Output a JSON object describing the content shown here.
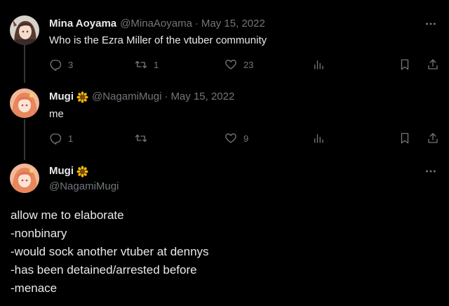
{
  "colors": {
    "background": "#000000",
    "text": "#e7e9ea",
    "muted": "#71767b",
    "thread_line": "#333639"
  },
  "tweets": [
    {
      "name": "Mina Aoyama",
      "handle": "@MinaAoyama",
      "separator": "·",
      "date": "May 15, 2022",
      "text": "Who is the Ezra Miller of the vtuber community",
      "avatar_icon": "avatar-mina-icon",
      "actions": {
        "reply": "3",
        "retweet": "1",
        "like": "23"
      }
    },
    {
      "name": "Mugi",
      "name_emoji": "sunflower-icon",
      "handle": "@NagamiMugi",
      "separator": "·",
      "date": "May 15, 2022",
      "text": "me",
      "avatar_icon": "avatar-mugi-icon",
      "actions": {
        "reply": "1",
        "retweet": "",
        "like": "9"
      }
    }
  ],
  "main_tweet": {
    "name": "Mugi",
    "name_emoji": "sunflower-icon",
    "handle": "@NagamiMugi",
    "avatar_icon": "avatar-mugi-icon",
    "lines": [
      "allow me to elaborate",
      "-nonbinary",
      "-would sock another vtuber at dennys",
      "-has been detained/arrested before",
      "-menace"
    ]
  }
}
